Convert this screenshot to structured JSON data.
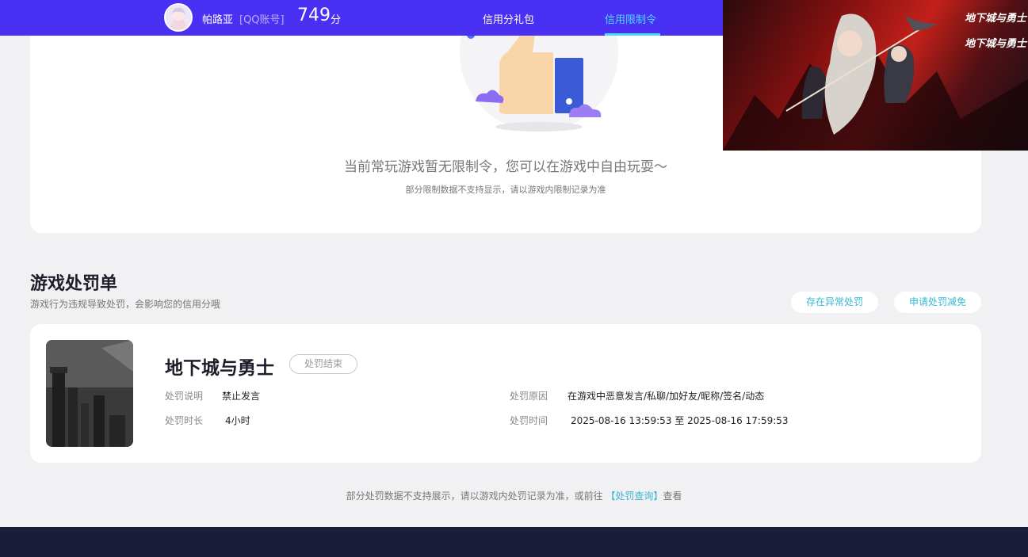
{
  "header": {
    "nickname": "帕路亚",
    "account_type": "[QQ账号]",
    "score": "749",
    "score_unit": "分",
    "nav": [
      "信用分礼包",
      "信用限制令"
    ],
    "active_nav_color": "#4fd8ff",
    "bar_color": "#4a30f2"
  },
  "banner": {
    "logo_text": [
      "地下城与勇士",
      "地下城与勇士"
    ]
  },
  "limit_card": {
    "message": "当前常玩游戏暂无限制令，您可以在游戏中自由玩耍～",
    "note": "部分限制数据不支持显示，请以游戏内限制记录为准"
  },
  "penalty_section": {
    "title": "游戏处罚单",
    "subtitle": "游戏行为违规导致处罚，会影响您的信用分哦",
    "buttons": [
      "存在异常处罚",
      "申请处罚减免"
    ]
  },
  "penalty": {
    "game_name": "地下城与勇士",
    "status": "处罚结束",
    "desc_label": "处罚说明",
    "desc_value": "禁止发言",
    "reason_label": "处罚原因",
    "reason_value": "在游戏中恶意发言/私聊/加好友/昵称/签名/动态",
    "duration_label": "处罚时长",
    "duration_value": "4小时",
    "time_label": "处罚时间",
    "time_value": "2025-08-16 13:59:53 至 2025-08-16 17:59:53"
  },
  "footer": {
    "note_prefix": "部分处罚数据不支持展示，请以游戏内处罚记录为准，或前往",
    "link": "【处罚查询】",
    "note_suffix": "查看"
  }
}
